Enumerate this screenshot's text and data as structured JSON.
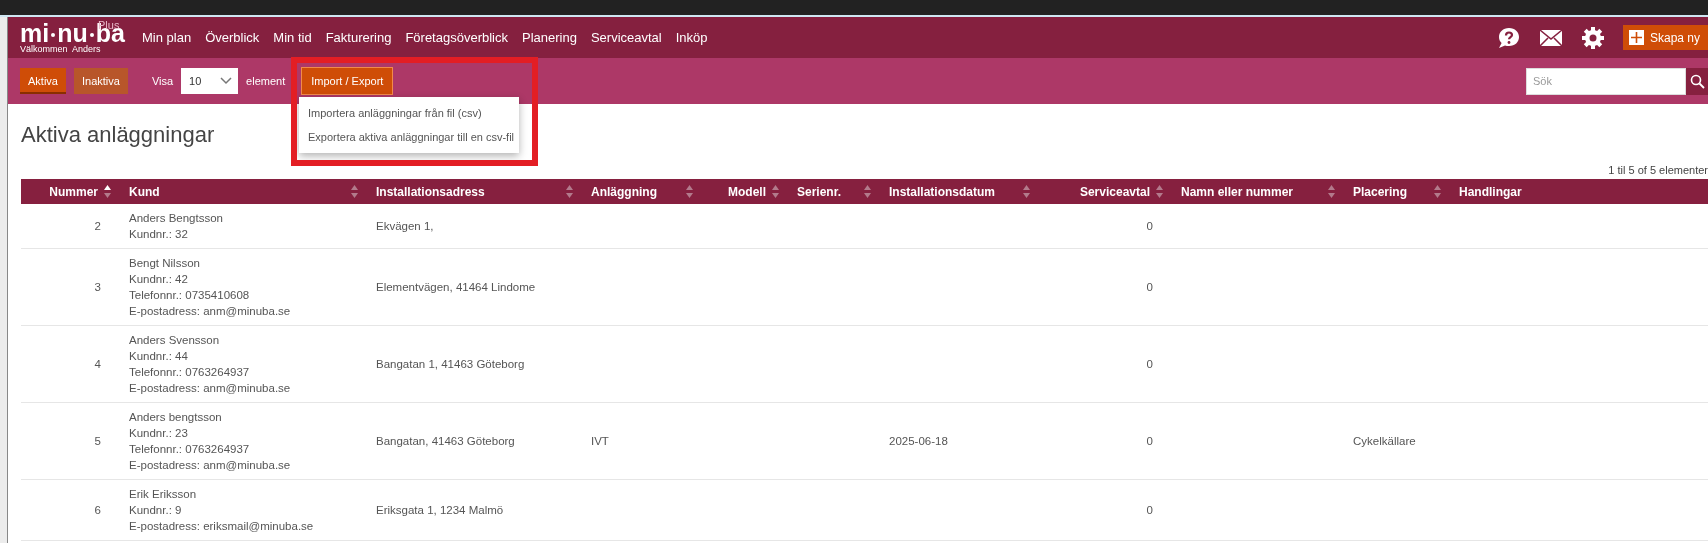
{
  "logo": {
    "parts": [
      "mi",
      "nu",
      "ba"
    ],
    "edition": "Plus",
    "greeting": "Välkommen  Anders"
  },
  "nav": [
    "Min plan",
    "Överblick",
    "Min tid",
    "Fakturering",
    "Företagsöverblick",
    "Planering",
    "Serviceavtal",
    "Inköp"
  ],
  "create_button": "Skapa ny",
  "toolbar": {
    "filters": [
      {
        "label": "Aktiva",
        "selected": true
      },
      {
        "label": "Inaktiva",
        "selected": false
      }
    ],
    "show_label": "Visa",
    "page_size": "10",
    "page_size_unit": "element",
    "import_export": {
      "label": "Import / Export",
      "expanded": true,
      "items": [
        "Importera anläggningar från fil (csv)",
        "Exportera aktiva anläggningar till en csv-fil"
      ]
    },
    "search": {
      "placeholder": "Sök"
    }
  },
  "heading": "Aktiva anläggningar",
  "count": "1 til 5 of 5 elementer",
  "table": {
    "columns": [
      {
        "label": "Nummer",
        "sortable": true,
        "sorted": true
      },
      {
        "label": "Kund",
        "sortable": true,
        "sorted": false
      },
      {
        "label": "Installationsadress",
        "sortable": true,
        "sorted": false
      },
      {
        "label": "Anläggning",
        "sortable": true,
        "sorted": false
      },
      {
        "label": "Modell",
        "sortable": true,
        "sorted": false
      },
      {
        "label": "Serienr.",
        "sortable": true,
        "sorted": false
      },
      {
        "label": "Installationsdatum",
        "sortable": true,
        "sorted": false
      },
      {
        "label": "Serviceavtal",
        "sortable": true,
        "sorted": false
      },
      {
        "label": "Namn eller nummer",
        "sortable": true,
        "sorted": false
      },
      {
        "label": "Placering",
        "sortable": true,
        "sorted": false
      },
      {
        "label": "Handlingar",
        "sortable": false
      }
    ],
    "rows": [
      {
        "number": "2",
        "customer": [
          "Anders Bengtsson",
          "Kundnr.: 32"
        ],
        "address": "Ekvägen 1,",
        "service_agreements": "0"
      },
      {
        "number": "3",
        "customer": [
          "Bengt Nilsson",
          "Kundnr.: 42",
          "Telefonnr.: 0735410608",
          "E-postadress: anm@minuba.se"
        ],
        "address": "Elementvägen, 41464 Lindome",
        "service_agreements": "0"
      },
      {
        "number": "4",
        "customer": [
          "Anders Svensson",
          "Kundnr.: 44",
          "Telefonnr.: 0763264937",
          "E-postadress: anm@minuba.se"
        ],
        "address": "Bangatan 1, 41463 Göteborg",
        "service_agreements": "0"
      },
      {
        "number": "5",
        "customer": [
          "Anders bengtsson",
          "Kundnr.: 23",
          "Telefonnr.: 0763264937",
          "E-postadress: anm@minuba.se"
        ],
        "address": "Bangatan, 41463 Göteborg",
        "system": "IVT",
        "installation_date": "2025-06-18",
        "service_agreements": "0",
        "placement": "Cykelkällare"
      },
      {
        "number": "6",
        "customer": [
          "Erik Eriksson",
          "Kundnr.: 9",
          "E-postadress: eriksmail@minuba.se"
        ],
        "address": "Eriksgata 1, 1234 Malmö",
        "service_agreements": "0"
      }
    ]
  }
}
